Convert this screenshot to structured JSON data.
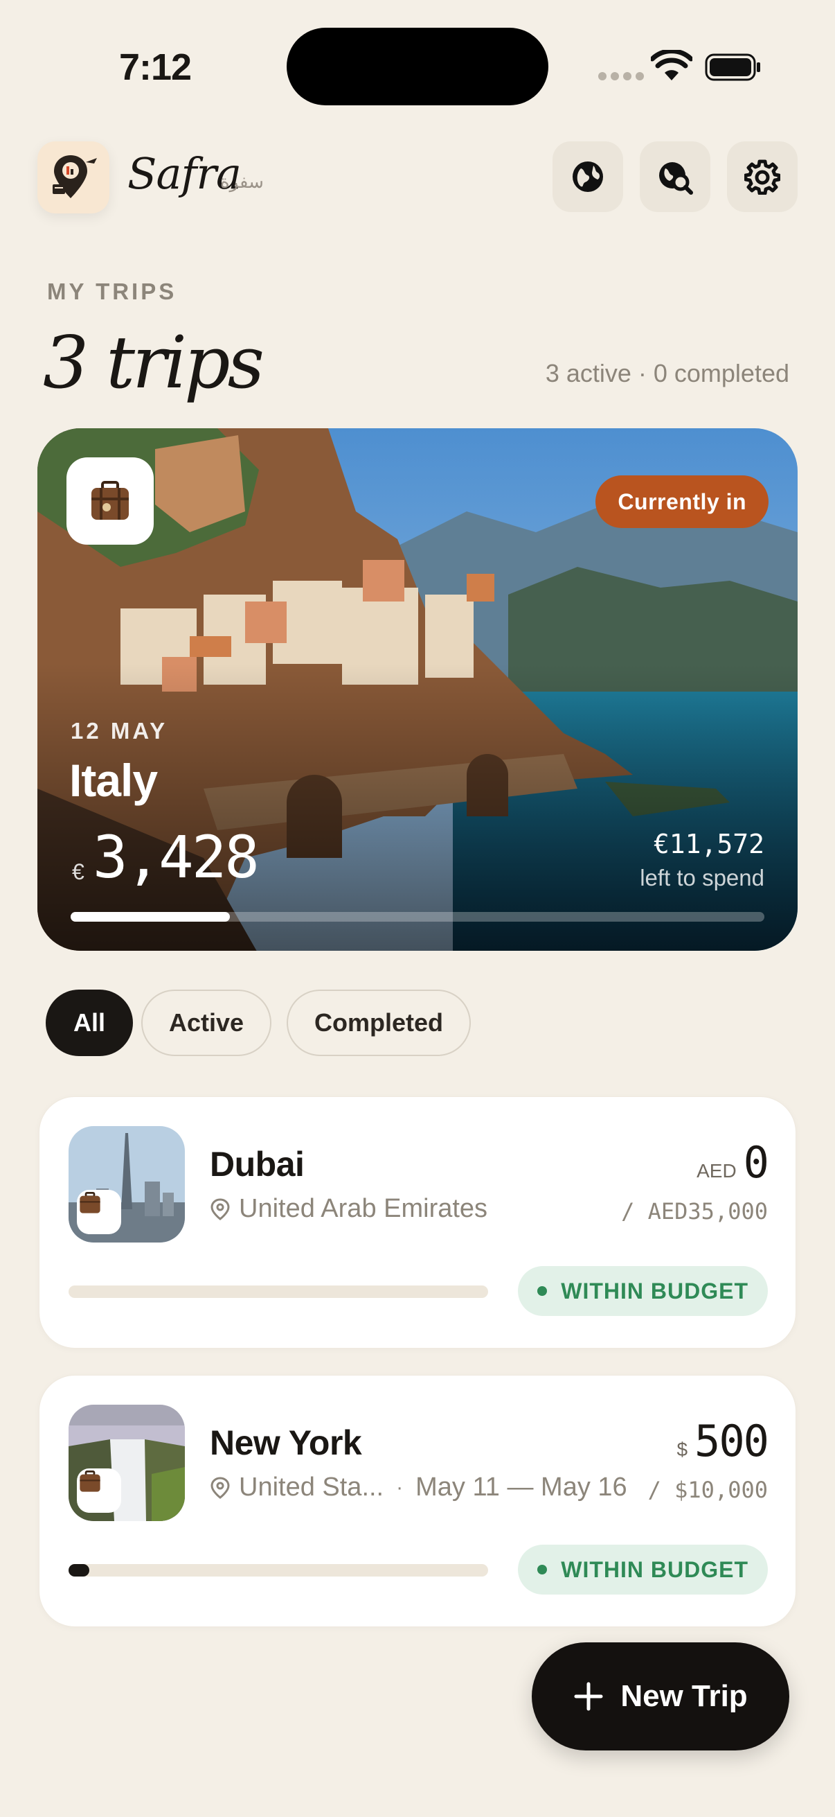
{
  "status_bar": {
    "time": "7:12"
  },
  "header": {
    "brand": "Safra",
    "brand_arabic": "سفرة",
    "icons": [
      "globe-icon",
      "world-search-icon",
      "gear-icon"
    ]
  },
  "section": {
    "eyebrow": "MY TRIPS",
    "title": "3 trips",
    "summary": "3 active · 0 completed"
  },
  "featured_trip": {
    "badge": "Currently in",
    "date": "12 MAY",
    "name": "Italy",
    "currency_symbol": "€",
    "spent": "3,428",
    "remaining": "€11,572",
    "remaining_label": "left to spend",
    "progress": 0.23
  },
  "filters": {
    "items": [
      {
        "label": "All",
        "active": true
      },
      {
        "label": "Active",
        "active": false
      },
      {
        "label": "Completed",
        "active": false
      }
    ]
  },
  "trips": [
    {
      "name": "Dubai",
      "location": "United Arab Emirates",
      "dates": "",
      "currency": "AED",
      "spent": "0",
      "budget": "/ AED35,000",
      "status": "WITHIN BUDGET",
      "progress": 0.0
    },
    {
      "name": "New York",
      "location": "United Sta...",
      "separator": "·",
      "dates": "May 11 — May 16",
      "currency": "$",
      "spent": "500",
      "budget": "/ $10,000",
      "status": "WITHIN BUDGET",
      "progress": 0.05
    }
  ],
  "fab": {
    "label": "New Trip"
  },
  "colors": {
    "background": "#F4EFE6",
    "accent_badge": "#B9541F",
    "status_green": "#2F8A56",
    "ink": "#1A1714"
  }
}
